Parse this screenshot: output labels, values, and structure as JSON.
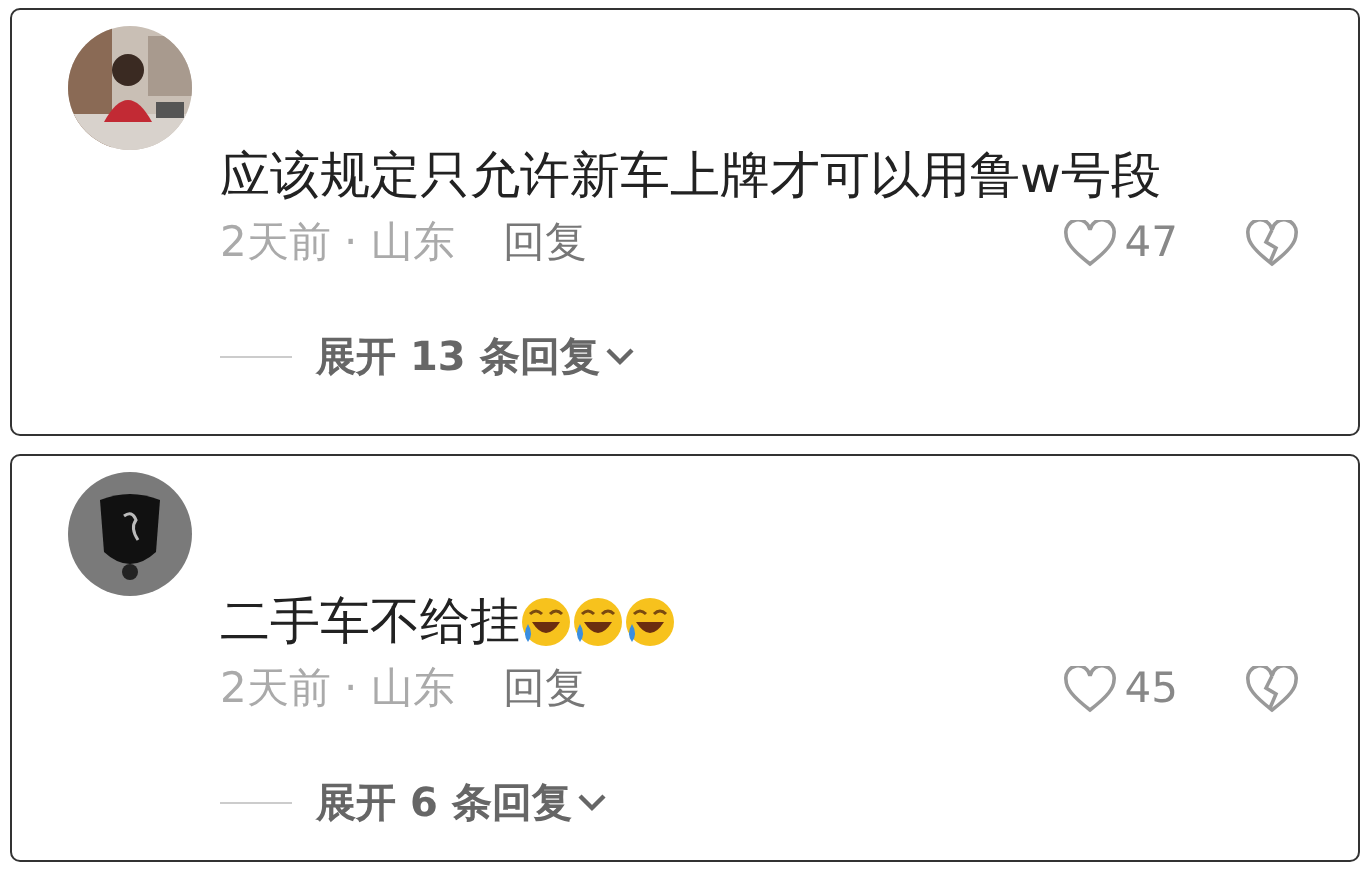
{
  "comments": [
    {
      "text": "应该规定只允许新车上牌才可以用鲁w号段",
      "meta": "2天前 · 山东",
      "reply": "回复",
      "likes": "47",
      "expand": "展开 13 条回复"
    },
    {
      "avatar": {
        "kind": "emblem"
      },
      "text": "二手车不给挂",
      "emojis": [
        {
          "kind": "laughing-crying"
        },
        {
          "kind": "laughing-crying"
        },
        {
          "kind": "laughing-crying"
        }
      ],
      "meta": "2天前 · 山东",
      "reply": "回复",
      "likes": "45",
      "expand": "展开 6 条回复"
    }
  ]
}
